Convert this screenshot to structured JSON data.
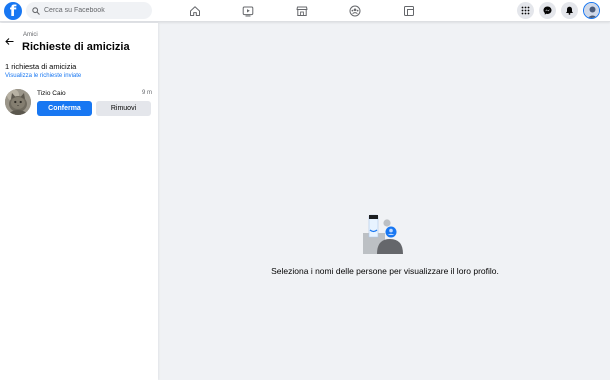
{
  "header": {
    "search_placeholder": "Cerca su Facebook",
    "logo_letter": "f"
  },
  "sidebar": {
    "breadcrumb": "Amici",
    "title": "Richieste di amicizia",
    "request_count": "1 richiesta di amicizia",
    "sent_requests_link": "Visualizza le richieste inviate",
    "requests": [
      {
        "name": "Tizio Caio",
        "time": "9 m",
        "confirm_label": "Conferma",
        "remove_label": "Rimuovi"
      }
    ]
  },
  "main": {
    "empty_message": "Seleziona i nomi delle persone per visualizzare il loro profilo."
  },
  "colors": {
    "brand": "#1877f2",
    "background": "#f0f2f5",
    "secondary_button": "#e4e6eb"
  }
}
